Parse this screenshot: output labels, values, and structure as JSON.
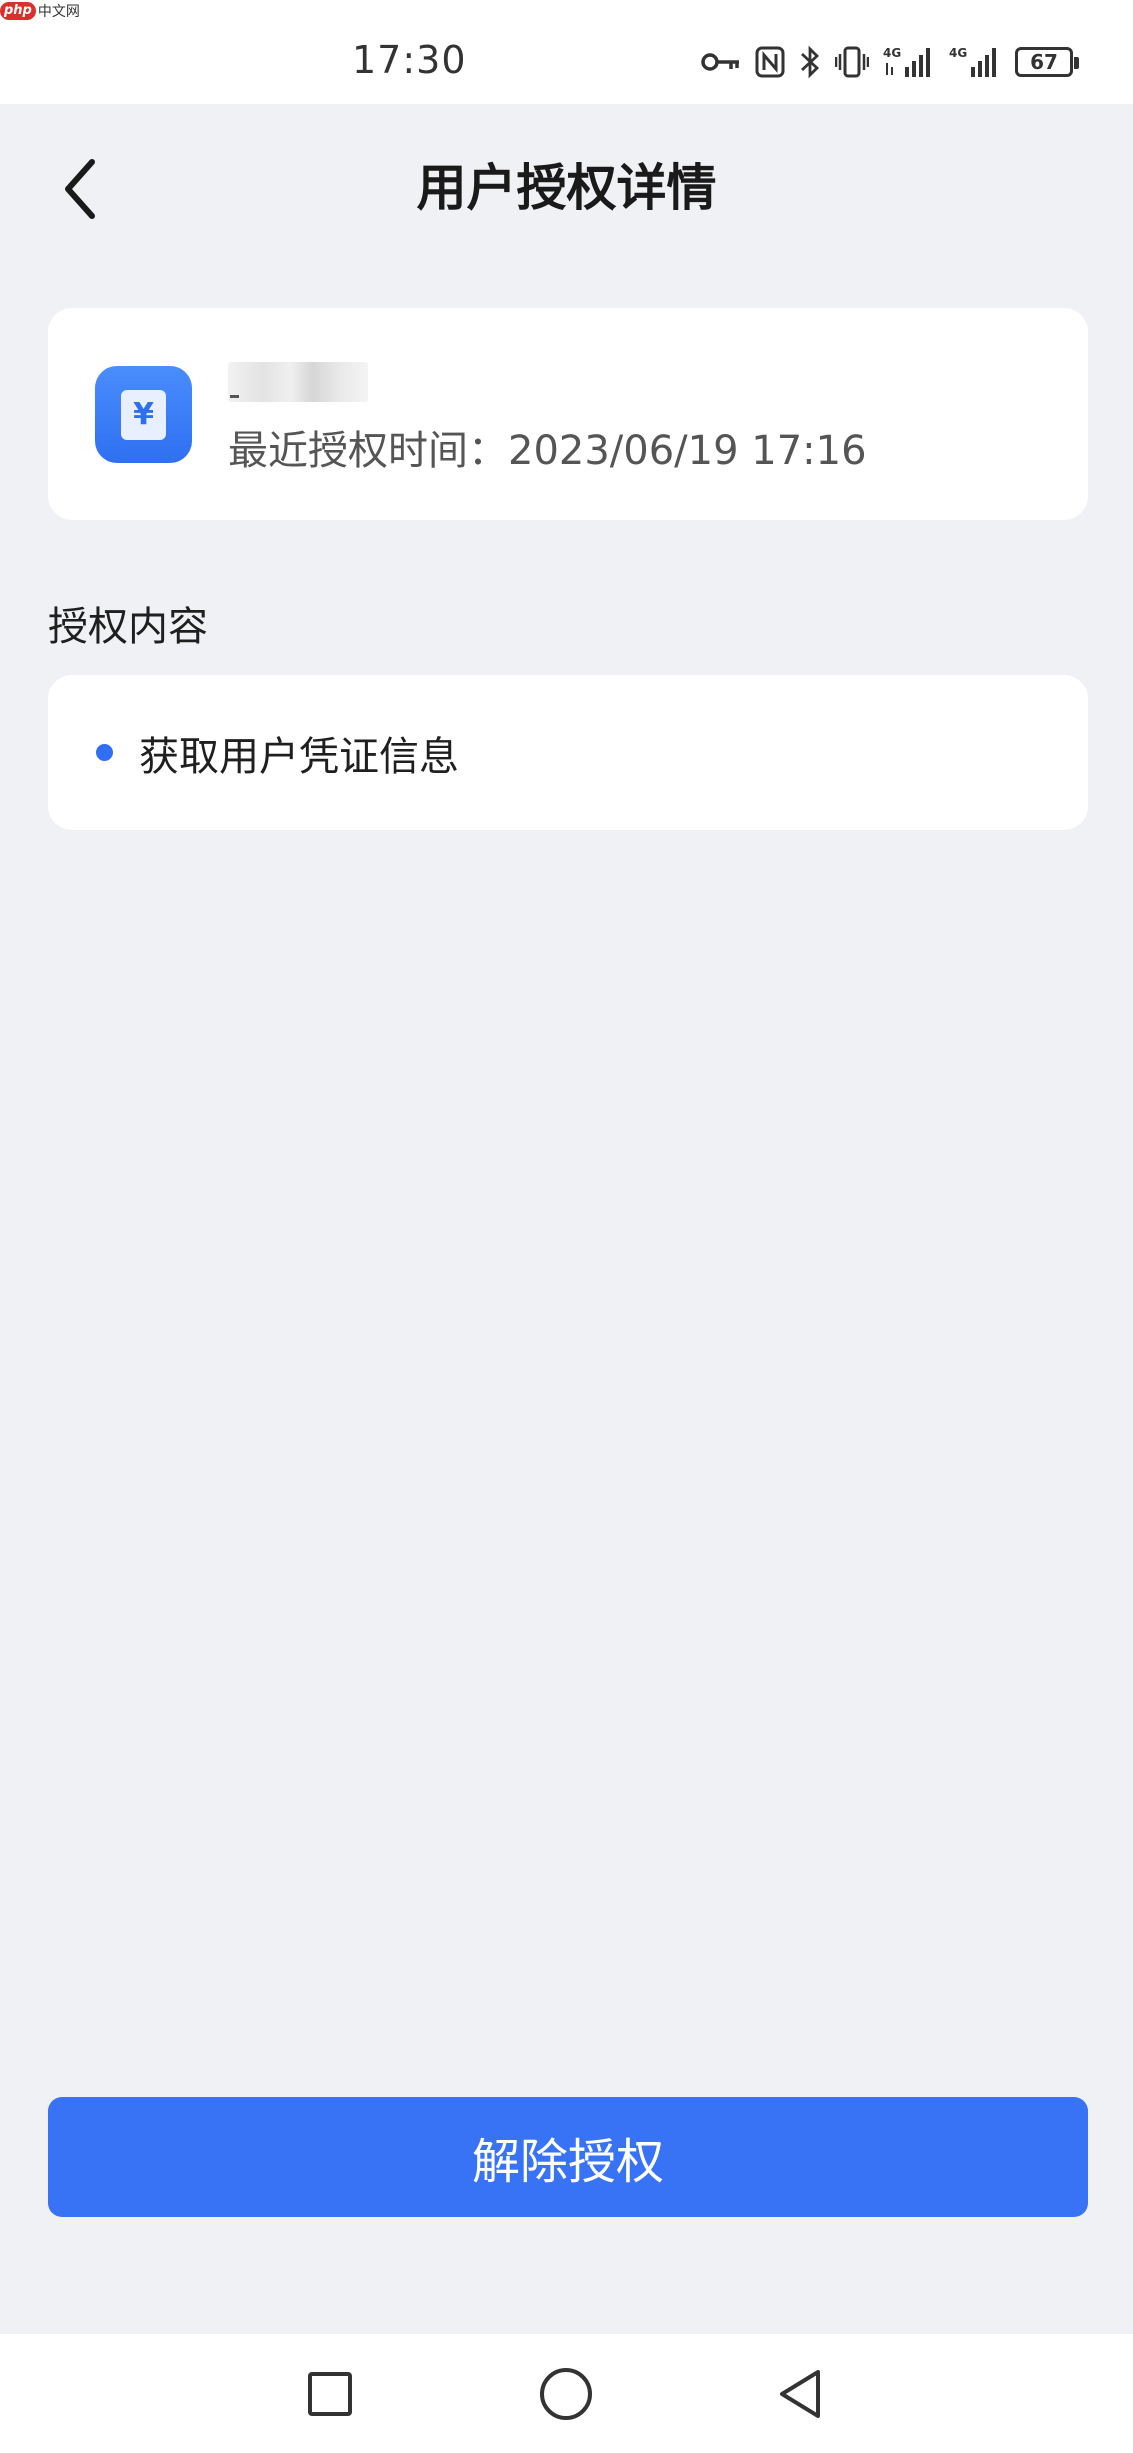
{
  "status_bar": {
    "watermark_logo": "php",
    "watermark_text": "中文网",
    "time": "17:30",
    "battery": "67",
    "icons": [
      "key-icon",
      "nfc-icon",
      "bluetooth-icon",
      "vibrate-icon",
      "signal-4g-icon",
      "signal-4g-icon",
      "battery-icon"
    ]
  },
  "header": {
    "title": "用户授权详情",
    "back_icon": "chevron-left-icon"
  },
  "app_card": {
    "icon": "yen-document-icon",
    "auth_time": "最近授权时间：2023/06/19 17:16"
  },
  "section": {
    "title": "授权内容",
    "items": [
      {
        "label": "获取用户凭证信息"
      }
    ]
  },
  "revoke_button": {
    "label": "解除授权"
  },
  "colors": {
    "accent": "#3873f6",
    "background": "#f0f1f5",
    "card": "#ffffff"
  },
  "system_nav": {
    "icons": [
      "recents-square-icon",
      "home-circle-icon",
      "back-triangle-icon"
    ]
  }
}
